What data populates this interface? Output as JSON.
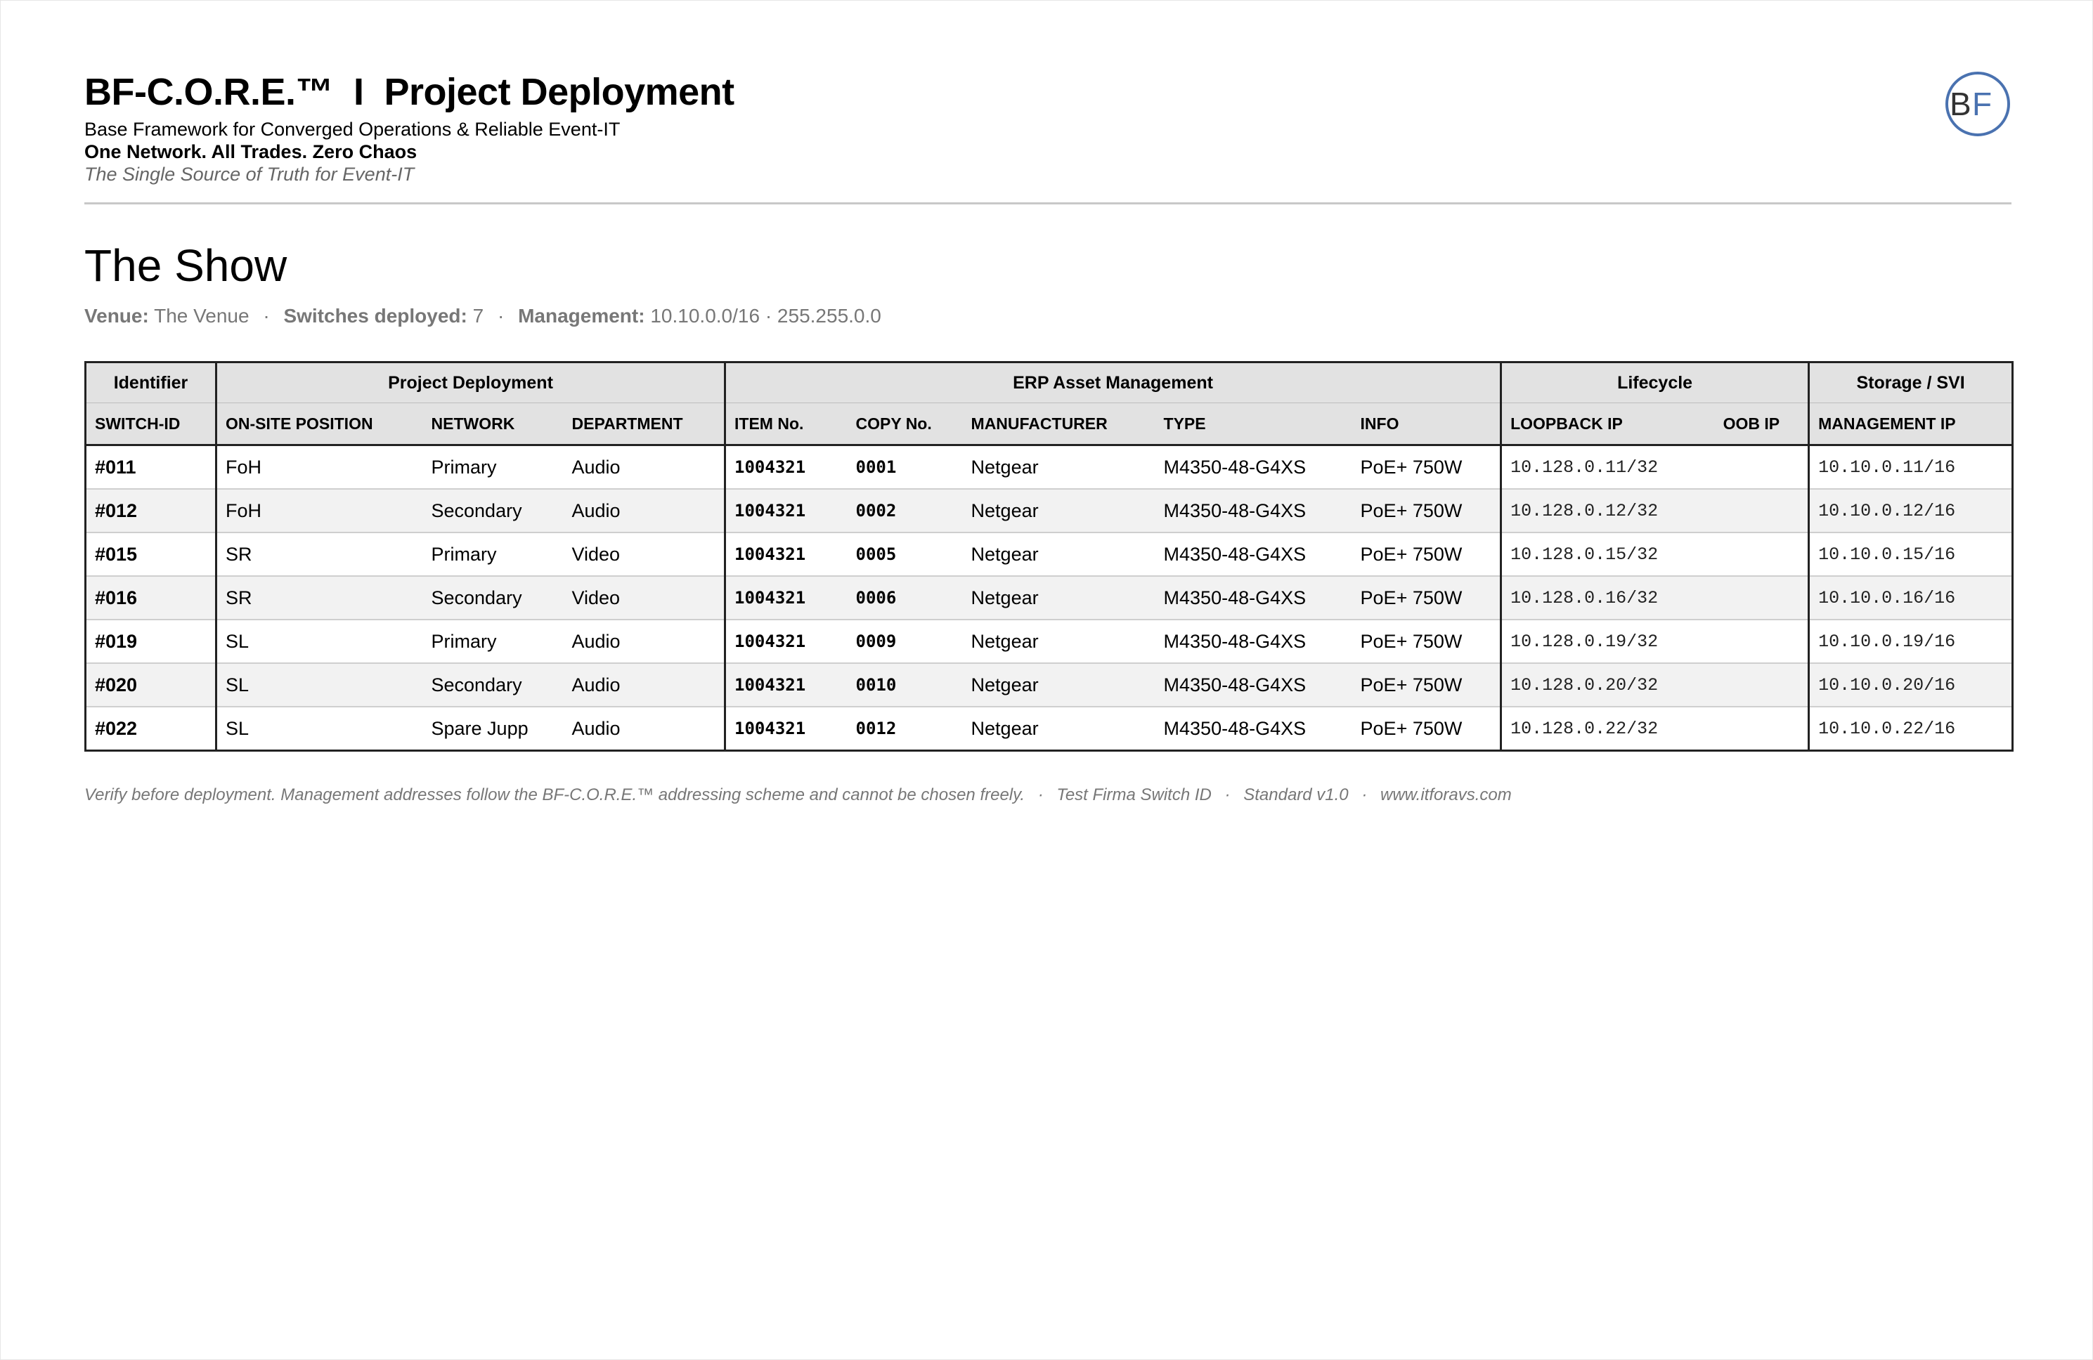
{
  "header": {
    "title": "BF-C.O.R.E.™  I  Project Deployment",
    "subtitle": "Base Framework for Converged Operations & Reliable Event-IT",
    "tagline": "One Network. All Trades. Zero Chaos",
    "motto": "The Single Source of Truth for Event-IT",
    "logo_text": "BF"
  },
  "show": {
    "title": "The Show",
    "venue_label": "Venue:",
    "venue": "The Venue",
    "switches_label": "Switches deployed:",
    "switches": "7",
    "management_label": "Management:",
    "management": "10.10.0.0/16 · 255.255.0.0"
  },
  "table": {
    "groups": [
      "Identifier",
      "Project Deployment",
      "ERP Asset Management",
      "Lifecycle",
      "Storage / SVI"
    ],
    "columns": [
      "SWITCH-ID",
      "ON-SITE POSITION",
      "NETWORK",
      "DEPARTMENT",
      "ITEM No.",
      "COPY No.",
      "MANUFACTURER",
      "TYPE",
      "INFO",
      "LOOPBACK IP",
      "OOB IP",
      "MANAGEMENT IP"
    ],
    "rows": [
      [
        "#011",
        "FoH",
        "Primary",
        "Audio",
        "1004321",
        "0001",
        "Netgear",
        "M4350-48-G4XS",
        "PoE+ 750W",
        "10.128.0.11/32",
        "",
        "10.10.0.11/16"
      ],
      [
        "#012",
        "FoH",
        "Secondary",
        "Audio",
        "1004321",
        "0002",
        "Netgear",
        "M4350-48-G4XS",
        "PoE+ 750W",
        "10.128.0.12/32",
        "",
        "10.10.0.12/16"
      ],
      [
        "#015",
        "SR",
        "Primary",
        "Video",
        "1004321",
        "0005",
        "Netgear",
        "M4350-48-G4XS",
        "PoE+ 750W",
        "10.128.0.15/32",
        "",
        "10.10.0.15/16"
      ],
      [
        "#016",
        "SR",
        "Secondary",
        "Video",
        "1004321",
        "0006",
        "Netgear",
        "M4350-48-G4XS",
        "PoE+ 750W",
        "10.128.0.16/32",
        "",
        "10.10.0.16/16"
      ],
      [
        "#019",
        "SL",
        "Primary",
        "Audio",
        "1004321",
        "0009",
        "Netgear",
        "M4350-48-G4XS",
        "PoE+ 750W",
        "10.128.0.19/32",
        "",
        "10.10.0.19/16"
      ],
      [
        "#020",
        "SL",
        "Secondary",
        "Audio",
        "1004321",
        "0010",
        "Netgear",
        "M4350-48-G4XS",
        "PoE+ 750W",
        "10.128.0.20/32",
        "",
        "10.10.0.20/16"
      ],
      [
        "#022",
        "SL",
        "Spare Jupp",
        "Audio",
        "1004321",
        "0012",
        "Netgear",
        "M4350-48-G4XS",
        "PoE+ 750W",
        "10.128.0.22/32",
        "",
        "10.10.0.22/16"
      ]
    ]
  },
  "footer": {
    "note": "Verify before deployment. Management addresses follow the BF-C.O.R.E.™ addressing scheme and cannot be chosen freely.",
    "firm": "Test Firma Switch ID",
    "standard": "Standard v1.0",
    "website": "www.itforavs.com"
  },
  "colors": {
    "logo_dark": "#333333",
    "logo_blue": "#4a72b0",
    "header_fill": "#e2e2e2",
    "zebra": "#f2f2f2",
    "muted_text": "#777777"
  }
}
